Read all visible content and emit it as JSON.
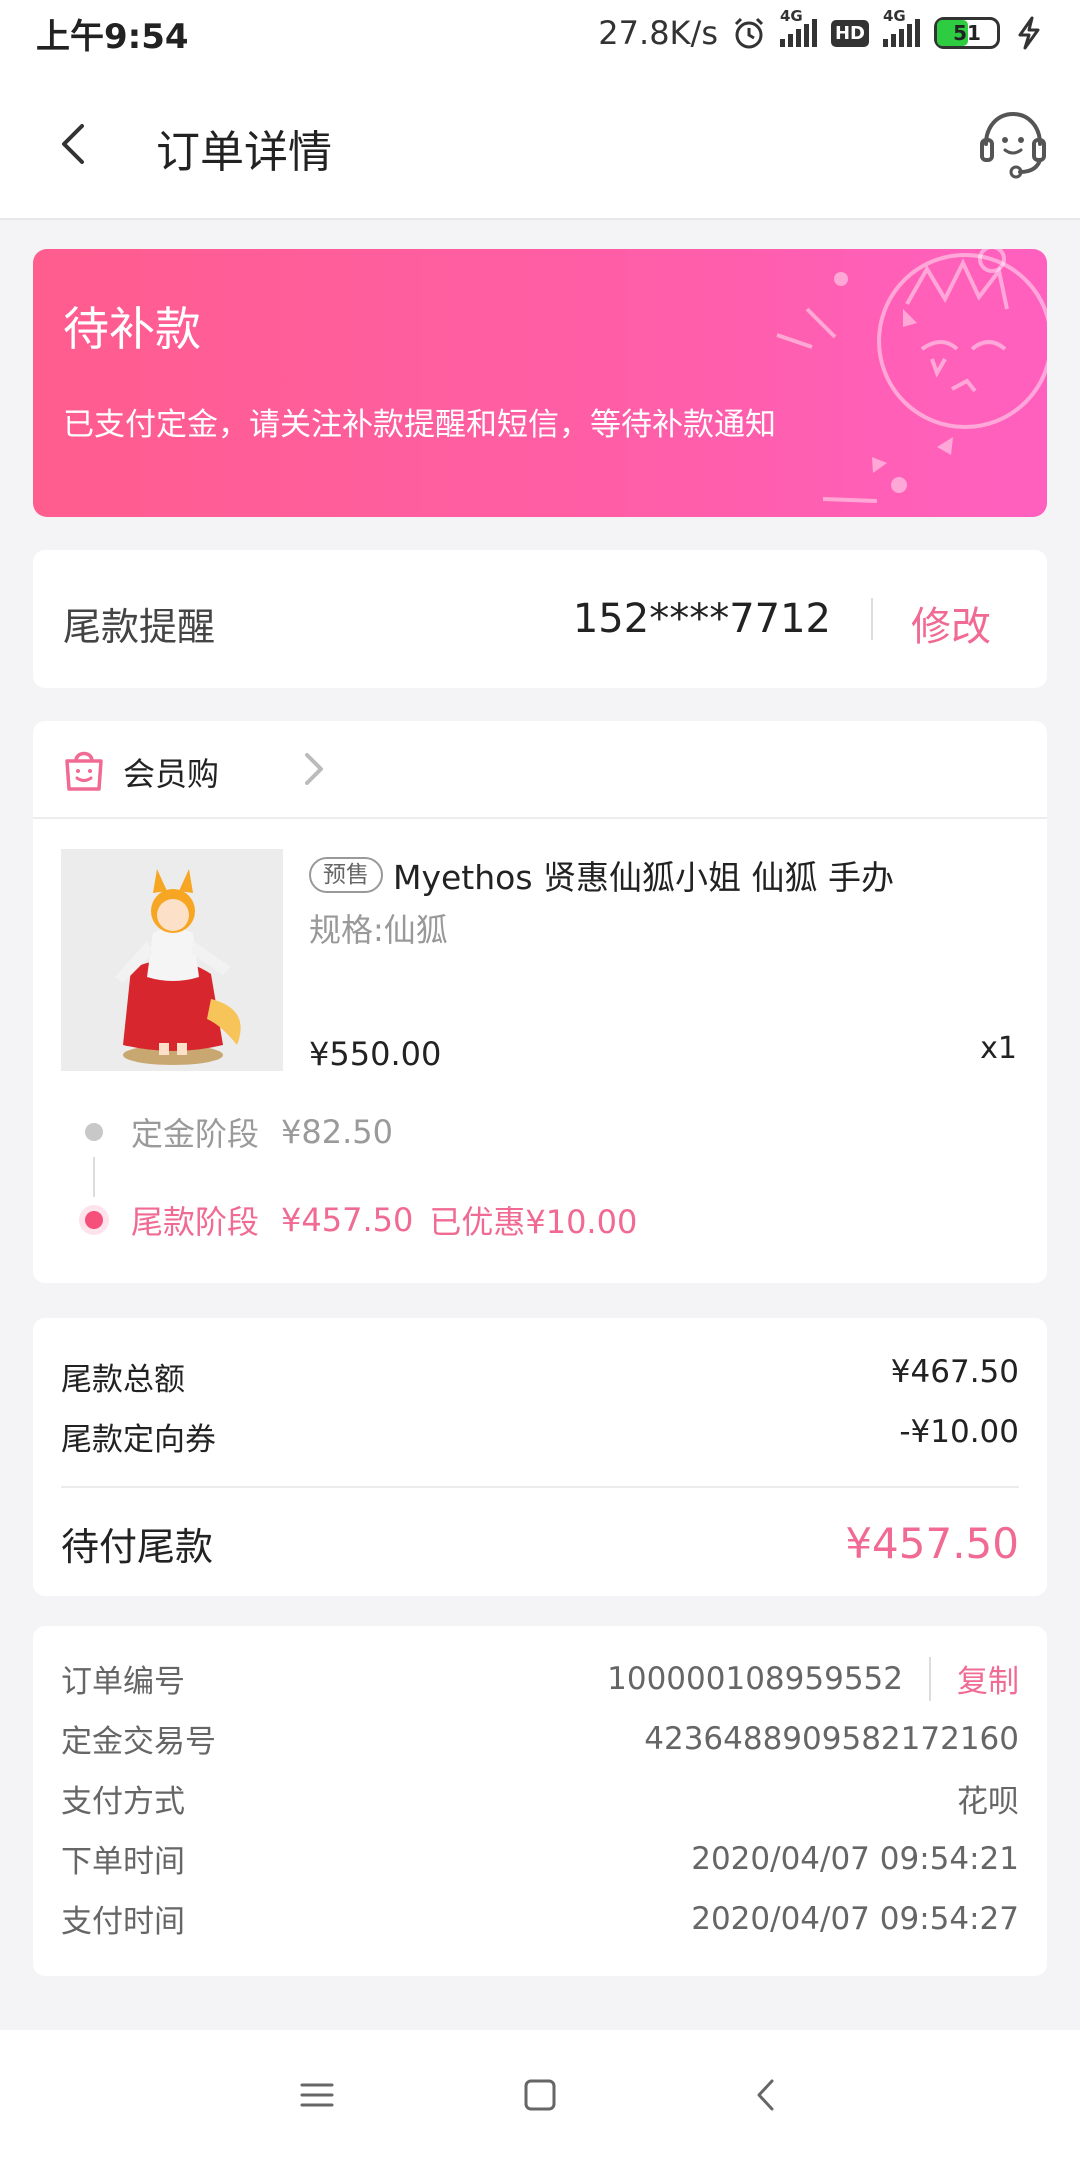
{
  "status_bar": {
    "time": "上午9:54",
    "net_speed": "27.8K/s",
    "network1": "4G",
    "hd": "HD",
    "network2": "4G",
    "battery": "51"
  },
  "header": {
    "title": "订单详情",
    "back_icon": "chevron-left-icon",
    "service_icon": "customer-service-icon"
  },
  "banner": {
    "title": "待补款",
    "subtitle": "已支付定金，请关注补款提醒和短信，等待补款通知"
  },
  "reminder": {
    "label": "尾款提醒",
    "phone": "152****7712",
    "edit": "修改"
  },
  "shop": {
    "name": "会员购",
    "icon": "shopping-bag-icon"
  },
  "product": {
    "badge": "预售",
    "title": "Myethos 贤惠仙狐小姐 仙狐 手办",
    "spec": "规格:仙狐",
    "price": "¥550.00",
    "qty": "x1",
    "image_icon": "figure-image"
  },
  "stages": {
    "deposit_label": "定金阶段",
    "deposit_amount": "¥82.50",
    "final_label": "尾款阶段",
    "final_amount": "¥457.50",
    "final_discount": "已优惠¥10.00"
  },
  "totals": {
    "total_label": "尾款总额",
    "total_value": "¥467.50",
    "coupon_label": "尾款定向券",
    "coupon_value": "-¥10.00",
    "pay_label": "待付尾款",
    "pay_value": "¥457.50"
  },
  "order_info": {
    "order_no_label": "订单编号",
    "order_no": "100000108959552",
    "copy": "复制",
    "deposit_tx_label": "定金交易号",
    "deposit_tx": "4236488909582172160",
    "pay_method_label": "支付方式",
    "pay_method": "花呗",
    "order_time_label": "下单时间",
    "order_time": "2020/04/07 09:54:21",
    "pay_time_label": "支付时间",
    "pay_time": "2020/04/07 09:54:27"
  },
  "colors": {
    "accent": "#f06a93",
    "banner_start": "#ff5d8e",
    "banner_end": "#ff60bf"
  }
}
